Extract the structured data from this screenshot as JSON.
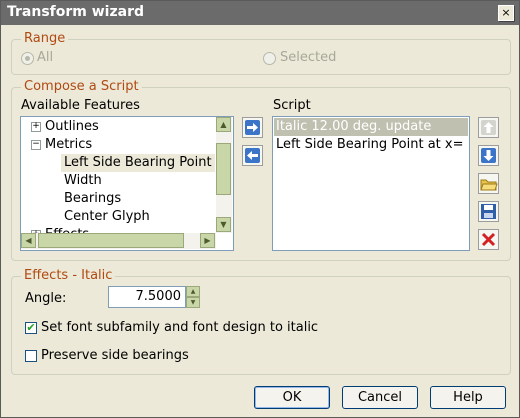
{
  "window": {
    "title": "Transform wizard",
    "close_glyph": "×"
  },
  "range": {
    "legend": "Range",
    "options": [
      {
        "label": "All",
        "checked": true
      },
      {
        "label": "Selected",
        "checked": false
      }
    ]
  },
  "compose": {
    "legend": "Compose a Script",
    "features_label": "Available Features",
    "features": [
      {
        "label": "Outlines",
        "expander": "+"
      },
      {
        "label": "Metrics",
        "expander": "−"
      },
      {
        "label": "Left Side Bearing Point"
      },
      {
        "label": "Width"
      },
      {
        "label": "Bearings"
      },
      {
        "label": "Center Glyph"
      },
      {
        "label": "Effects",
        "expander": "+"
      }
    ],
    "script_label": "Script",
    "script_items": [
      {
        "label": "Italic 12.00 deg.  update"
      },
      {
        "label": "Left Side Bearing Point at x="
      }
    ],
    "add_glyph": "➔",
    "remove_glyph": "⬅"
  },
  "effects": {
    "legend": "Effects - Italic",
    "angle_label": "Angle:",
    "angle_value": "7.5000",
    "set_italic_label": "Set font subfamily and font design to italic",
    "set_italic_checked": true,
    "preserve_label": "Preserve side bearings",
    "preserve_checked": false
  },
  "buttons": {
    "ok": "OK",
    "cancel": "Cancel",
    "help": "Help"
  },
  "colors": {
    "accent": "#b04a12",
    "selection": "#ece9d8",
    "titlebar": "#6b6b6b"
  }
}
